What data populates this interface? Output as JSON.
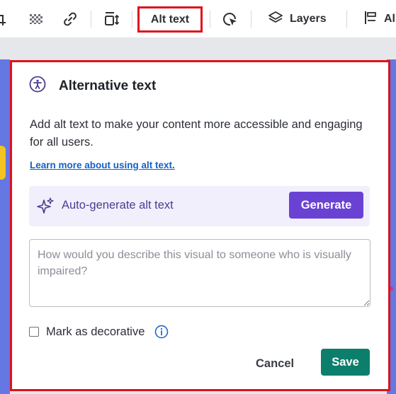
{
  "toolbar": {
    "alt_text_label": "Alt text",
    "layers_label": "Layers",
    "al_label": "Al",
    "icons": [
      "crop-icon",
      "transparency-icon",
      "link-icon",
      "position-icon",
      "animate-icon",
      "layers-icon",
      "align-icon"
    ]
  },
  "dialog": {
    "title": "Alternative text",
    "description": "Add alt text to make your content more accessible and engaging for all users.",
    "learn_more_link": "Learn more about using alt text.",
    "auto_generate_label": "Auto-generate alt text",
    "generate_button": "Generate",
    "textarea_value": "",
    "textarea_placeholder": "How would you describe this visual to someone who is visually impaired?",
    "decorative_label": "Mark as decorative",
    "decorative_checked": false,
    "cancel_button": "Cancel",
    "save_button": "Save"
  },
  "colors": {
    "highlight_border": "#e0111b",
    "accent_purple": "#6a42d3",
    "save_green": "#0b7f6b",
    "link_blue": "#1260c9",
    "auto_box_bg": "#f2effd"
  }
}
